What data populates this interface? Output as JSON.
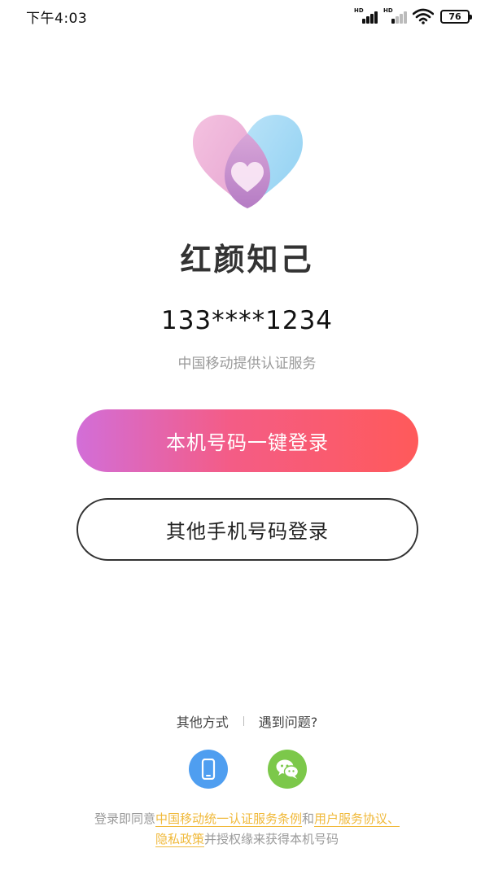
{
  "status_bar": {
    "time": "下午4:03",
    "signal1_label": "HD",
    "signal2_label": "HD",
    "battery": "76"
  },
  "app": {
    "name": "红颜知己",
    "logo_icon": "heart-logo-icon"
  },
  "login": {
    "masked_number": "133****1234",
    "provider_text": "中国移动提供认证服务",
    "one_click_button": "本机号码一键登录",
    "other_phone_button": "其他手机号码登录"
  },
  "other_methods": {
    "label": "其他方式",
    "help": "遇到问题?",
    "icons": [
      "phone-icon",
      "wechat-icon"
    ]
  },
  "agreement": {
    "prefix": "登录即同意",
    "link1": "中国移动统一认证服务条例",
    "and": "和",
    "link2": "用户服务协议、",
    "link3": "隐私政策",
    "suffix": "并授权缘来获得本机号码"
  },
  "colors": {
    "gradient_start": "#d26ed8",
    "gradient_end": "#ff5a5a",
    "link": "#f0b93a",
    "phone_icon_bg": "#4f9ef0",
    "wechat_icon_bg": "#7cc84a"
  }
}
